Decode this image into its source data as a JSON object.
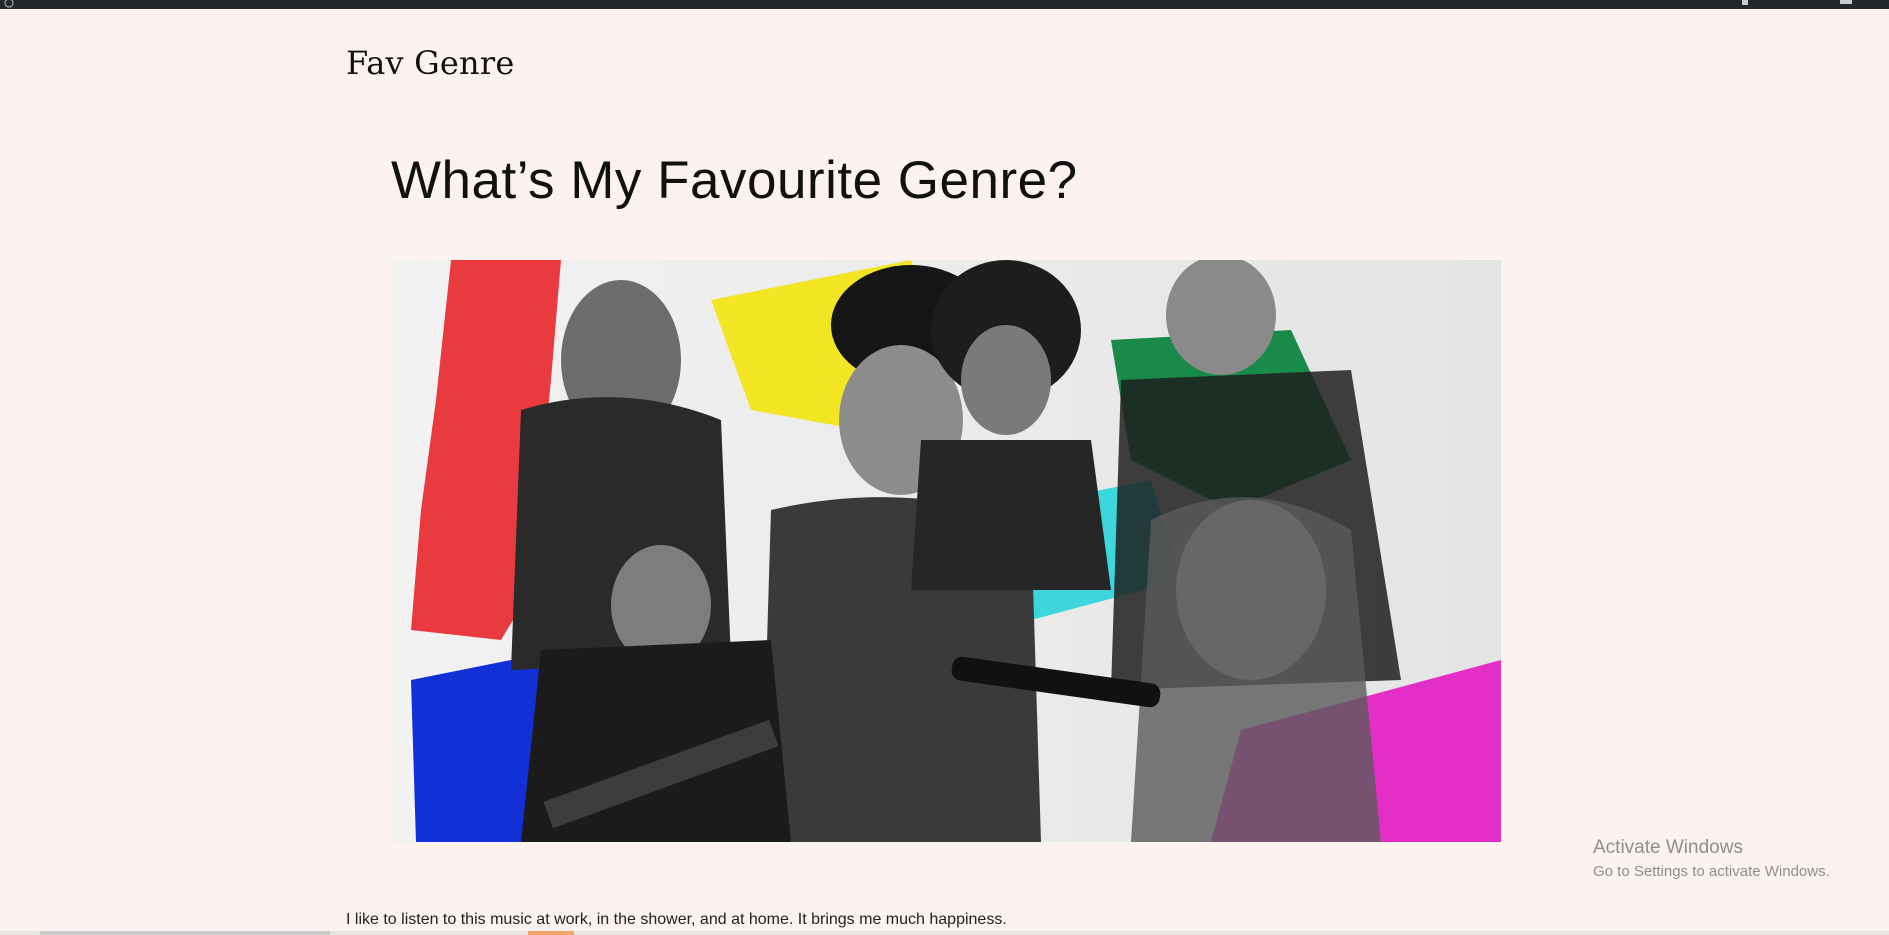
{
  "admin_bar": {
    "icons": [
      "wordpress-icon",
      "notification-icon",
      "user-icon"
    ]
  },
  "site": {
    "title": "Fav Genre"
  },
  "post": {
    "title": "What’s My Favourite Genre?",
    "body": "I like to listen to this music at work, in the shower, and at home. It brings me much happiness."
  },
  "hero_image": {
    "description_icon": "image-icon",
    "accent_colors": [
      "#e8262b",
      "#f3e400",
      "#1a8a4a",
      "#1fd4d8",
      "#1330d6",
      "#e21bc2",
      "#f36a2a"
    ]
  },
  "watermark": {
    "title": "Activate Windows",
    "subtitle": "Go to Settings to activate Windows."
  }
}
